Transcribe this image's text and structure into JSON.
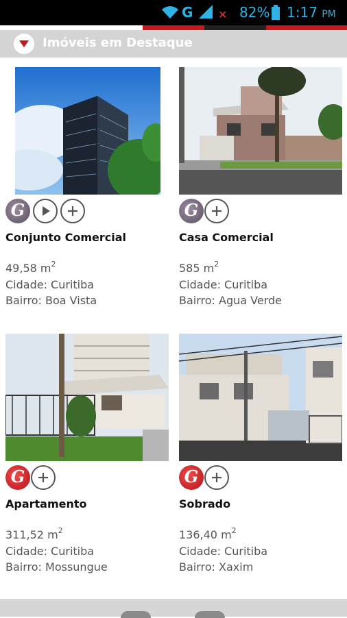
{
  "status_bar": {
    "network": "G",
    "battery_pct": "82%",
    "time": "1:17",
    "ampm": "PM",
    "icons": [
      "wifi-icon",
      "signal-icon",
      "sim-x-icon",
      "battery-icon"
    ]
  },
  "section": {
    "title": "Imóveis em Destaque",
    "toggle_icon": "chevron-down-icon"
  },
  "listings": [
    {
      "name": "Conjunto Comercial",
      "area": "49,58 m",
      "area_unit_sup": "2",
      "city": "Cidade: Curitiba",
      "neighborhood": "Bairro: Boa Vista",
      "logo_style": "gray",
      "actions": [
        "play-icon",
        "plus-icon"
      ]
    },
    {
      "name": "Casa Comercial",
      "area": "585 m",
      "area_unit_sup": "2",
      "city": "Cidade: Curitiba",
      "neighborhood": "Bairro: Agua Verde",
      "logo_style": "gray",
      "actions": [
        "plus-icon"
      ]
    },
    {
      "name": "Apartamento",
      "area": "311,52 m",
      "area_unit_sup": "2",
      "city": "Cidade: Curitiba",
      "neighborhood": "Bairro: Mossungue",
      "logo_style": "red",
      "actions": [
        "plus-icon"
      ]
    },
    {
      "name": "Sobrado",
      "area": "136,40 m",
      "area_unit_sup": "2",
      "city": "Cidade: Curitiba",
      "neighborhood": "Bairro: Xaxim",
      "logo_style": "red",
      "actions": [
        "plus-icon"
      ]
    }
  ],
  "logo_letter": "G",
  "colors": {
    "accent_red": "#c8161d",
    "header_bg": "#d4d4d4",
    "status_blue": "#2fb2e6"
  }
}
